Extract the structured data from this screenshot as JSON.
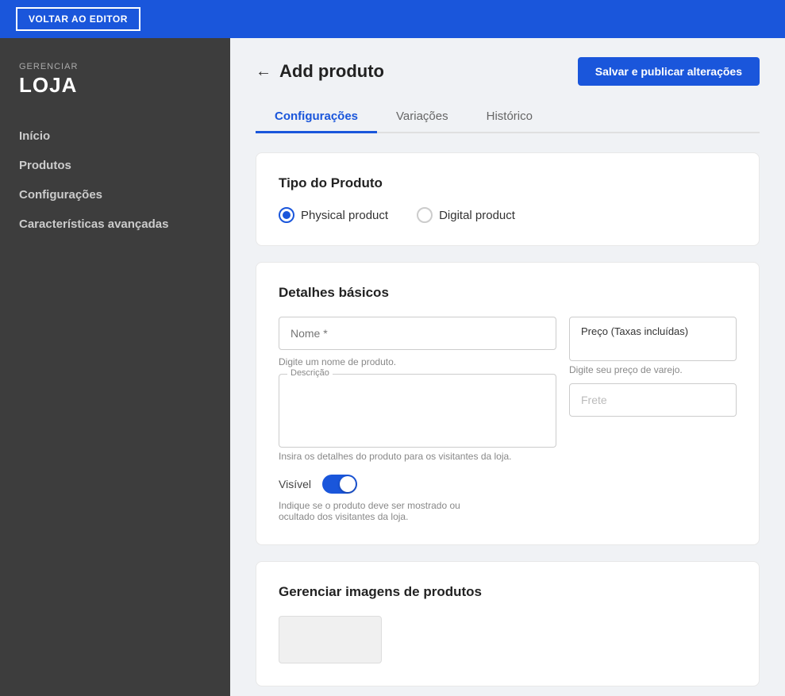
{
  "topbar": {
    "back_button": "VOLTAR AO EDITOR"
  },
  "sidebar": {
    "manage_label": "GERENCIAR",
    "store_label": "LOJA",
    "nav_items": [
      {
        "label": "Início",
        "id": "inicio"
      },
      {
        "label": "Produtos",
        "id": "produtos"
      },
      {
        "label": "Configurações",
        "id": "configuracoes"
      },
      {
        "label": "Características avançadas",
        "id": "avancadas"
      }
    ]
  },
  "header": {
    "back_arrow": "←",
    "title": "Add produto",
    "save_button": "Salvar e publicar alterações"
  },
  "tabs": [
    {
      "label": "Configurações",
      "active": true
    },
    {
      "label": "Variações",
      "active": false
    },
    {
      "label": "Histórico",
      "active": false
    }
  ],
  "product_type_card": {
    "title": "Tipo do Produto",
    "options": [
      {
        "label": "Physical product",
        "selected": true
      },
      {
        "label": "Digital product",
        "selected": false
      }
    ]
  },
  "basic_details_card": {
    "title": "Detalhes básicos",
    "name_placeholder": "Nome *",
    "name_helper": "Digite um nome de produto.",
    "description_label": "Descrição",
    "description_placeholder": "",
    "description_helper": "Insira os detalhes do produto para os visitantes da loja.",
    "price_label": "Preço (Taxas incluídas)",
    "price_helper": "Digite seu preço de varejo.",
    "frete_placeholder": "Frete",
    "visible_label": "Visível",
    "visible_hint": "Indique se o produto deve ser mostrado ou ocultado dos visitantes da loja."
  },
  "images_card": {
    "title": "Gerenciar imagens de produtos"
  }
}
